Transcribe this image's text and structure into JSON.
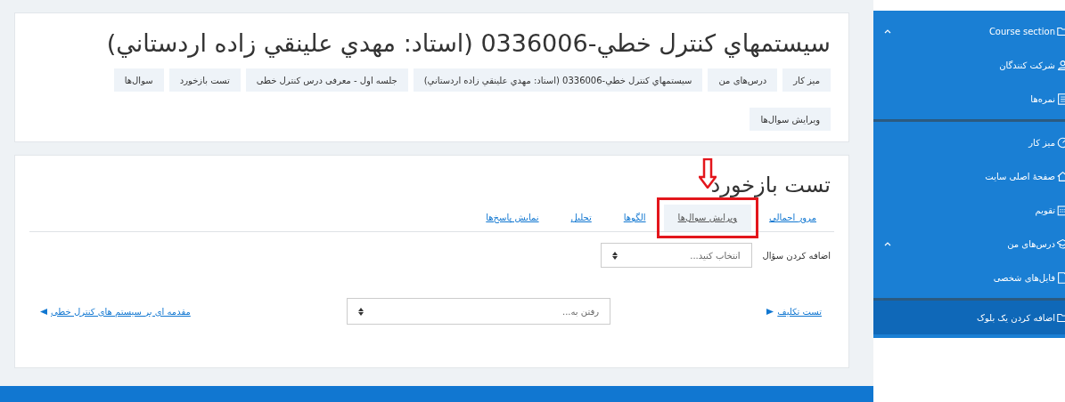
{
  "page_header": {
    "title": "سیستمهاي کنترل خطي-0336006 (استاد: مهدي علينقي زاده اردستاني)",
    "breadcrumb": [
      {
        "label": "میز کار"
      },
      {
        "label": "درس‌های من"
      },
      {
        "label": "سیستمهاي کنترل خطي-0336006 (استاد: مهدي علينقي زاده اردستاني)"
      },
      {
        "label": "جلسه اول - معرفی درس کنترل خطی"
      },
      {
        "label": "تست بازخورد"
      },
      {
        "label": "سوال‌ها"
      }
    ],
    "action_button": "ویرایش سوال‌ها"
  },
  "activity": {
    "title": "تست بازخورد",
    "tabs": [
      {
        "label": "مرور اجمالی",
        "selected": false,
        "highlighted": false
      },
      {
        "label": "ویرایش سوال‌ها",
        "selected": true,
        "highlighted": true
      },
      {
        "label": "الگوها",
        "selected": false,
        "highlighted": false
      },
      {
        "label": "تحلیل",
        "selected": false,
        "highlighted": false
      },
      {
        "label": "نمایش پاسخ‌ها",
        "selected": false,
        "highlighted": false
      }
    ],
    "add_question": {
      "label": "اضافه کردن سؤال",
      "placeholder": "انتخاب کنید..."
    },
    "previous_link": "تست تکلیف",
    "jump_to": {
      "placeholder": "رفتن به..."
    },
    "next_link": "مقدمه ای بر سیستم های کنترل خطی"
  },
  "sidebar": {
    "groups": [
      {
        "items": [
          {
            "label": "Course section",
            "expandable": true,
            "selected": false
          },
          {
            "label": "شرکت کنندگان",
            "expandable": false,
            "selected": false
          },
          {
            "label": "نمره‌ها",
            "expandable": false,
            "selected": false
          }
        ]
      },
      {
        "items": [
          {
            "label": "میز کار",
            "expandable": false,
            "selected": false
          },
          {
            "label": "صفحهٔ اصلی سایت",
            "expandable": false,
            "selected": false
          },
          {
            "label": "تقویم",
            "expandable": false,
            "selected": false
          },
          {
            "label": "درس‌های من",
            "expandable": true,
            "selected": false
          },
          {
            "label": "فایل‌های شخصی",
            "expandable": false,
            "selected": false
          }
        ]
      },
      {
        "items": [
          {
            "label": "اضافه کردن یک بلوک",
            "expandable": false,
            "selected": true
          }
        ]
      }
    ]
  }
}
